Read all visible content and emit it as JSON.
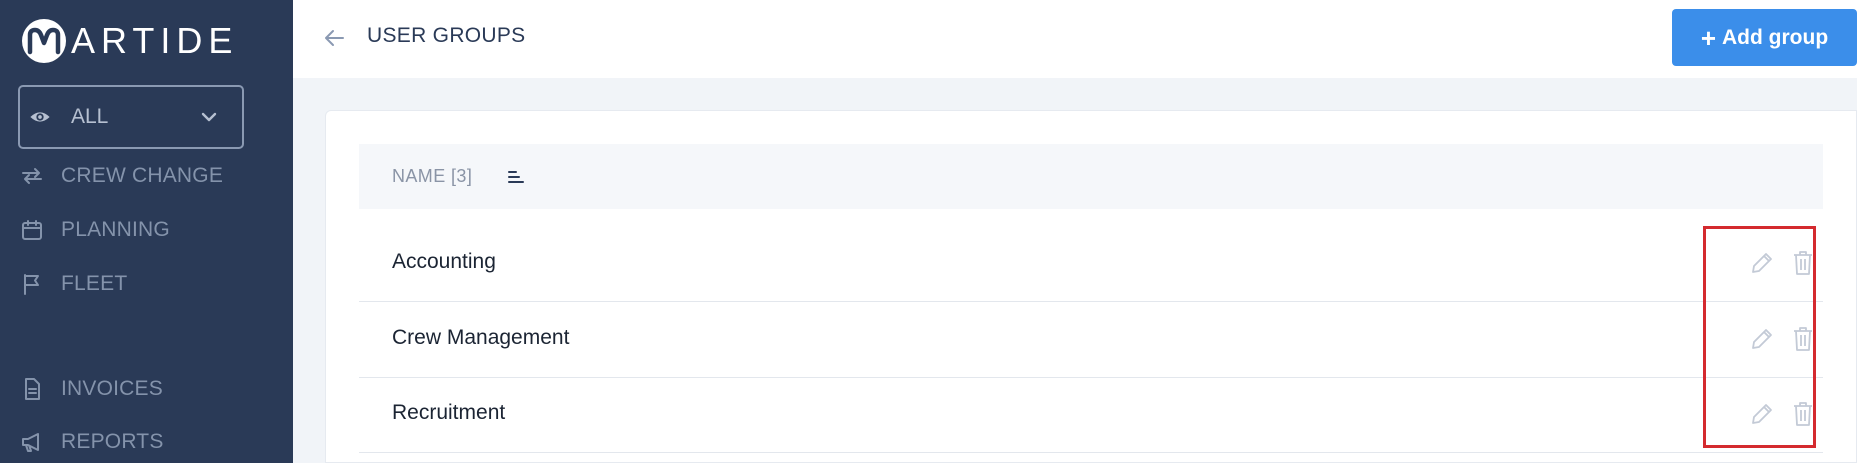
{
  "brand": {
    "logo_text": "ARTIDE",
    "logo_letter": "M"
  },
  "sidebar": {
    "filter": {
      "icon": "eye-icon",
      "value": "ALL"
    },
    "items": [
      {
        "label": "CREW CHANGE",
        "icon": "swap-arrows-icon"
      },
      {
        "label": "PLANNING",
        "icon": "calendar-icon"
      },
      {
        "label": "FLEET",
        "icon": "flag-icon"
      },
      {
        "label": "INVOICES",
        "icon": "document-icon"
      },
      {
        "label": "REPORTS",
        "icon": "megaphone-icon"
      }
    ]
  },
  "header": {
    "title": "USER GROUPS",
    "add_button_label": "Add group",
    "add_button_symbol": "+"
  },
  "table": {
    "column_header": "NAME [3]",
    "rows": [
      {
        "name": "Accounting"
      },
      {
        "name": "Crew Management"
      },
      {
        "name": "Recruitment"
      }
    ]
  },
  "colors": {
    "sidebar_bg": "#2a3a57",
    "accent": "#3b8eea",
    "highlight": "#d42a2f"
  }
}
